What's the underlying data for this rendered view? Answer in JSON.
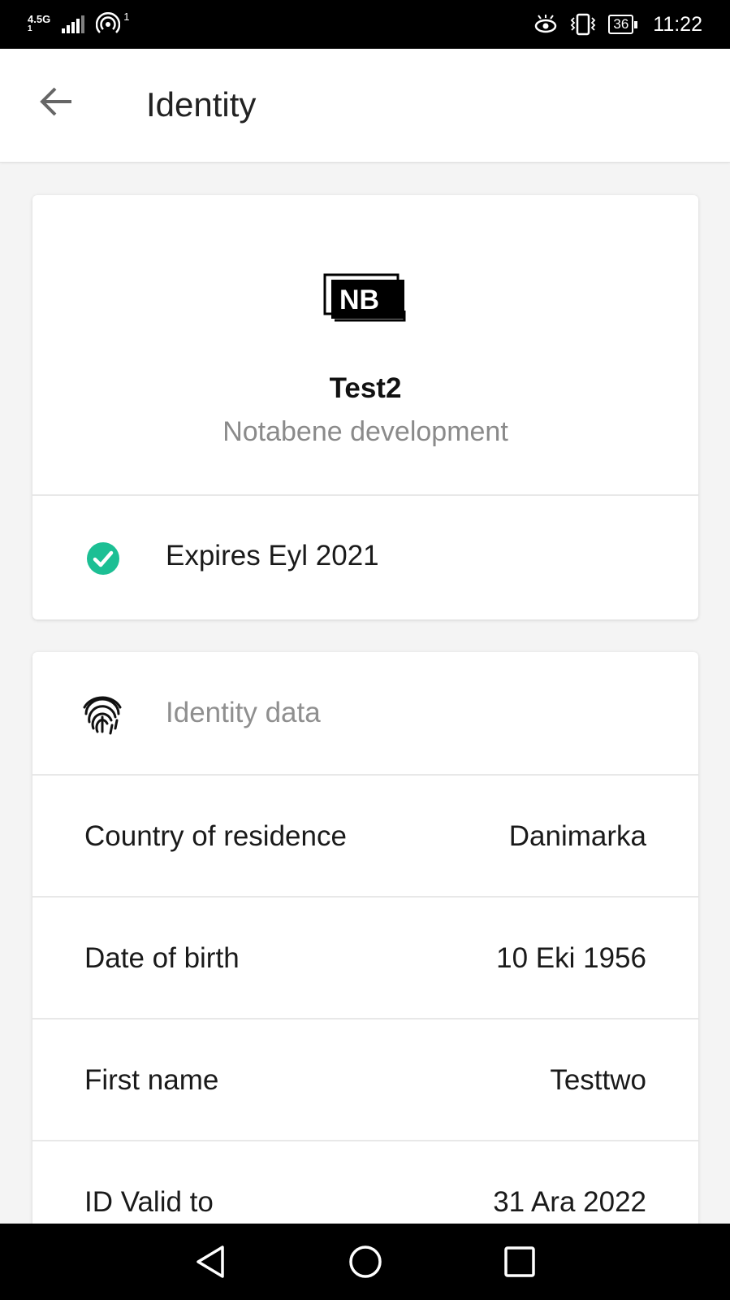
{
  "status_bar": {
    "network_type": "4.5G",
    "network_sub": "1",
    "hotspot_count": "1",
    "battery": "36",
    "time": "11:22"
  },
  "app_bar": {
    "title": "Identity"
  },
  "identity_card": {
    "logo_text": "NB",
    "name": "Test2",
    "issuer": "Notabene development",
    "expiry": "Expires Eyl 2021",
    "status_color": "#1cbf94"
  },
  "identity_data": {
    "header": "Identity data",
    "rows": [
      {
        "label": "Country of residence",
        "value": "Danimarka"
      },
      {
        "label": "Date of birth",
        "value": "10 Eki 1956"
      },
      {
        "label": "First name",
        "value": "Testtwo"
      },
      {
        "label": "ID Valid to",
        "value": "31 Ara 2022"
      }
    ]
  }
}
